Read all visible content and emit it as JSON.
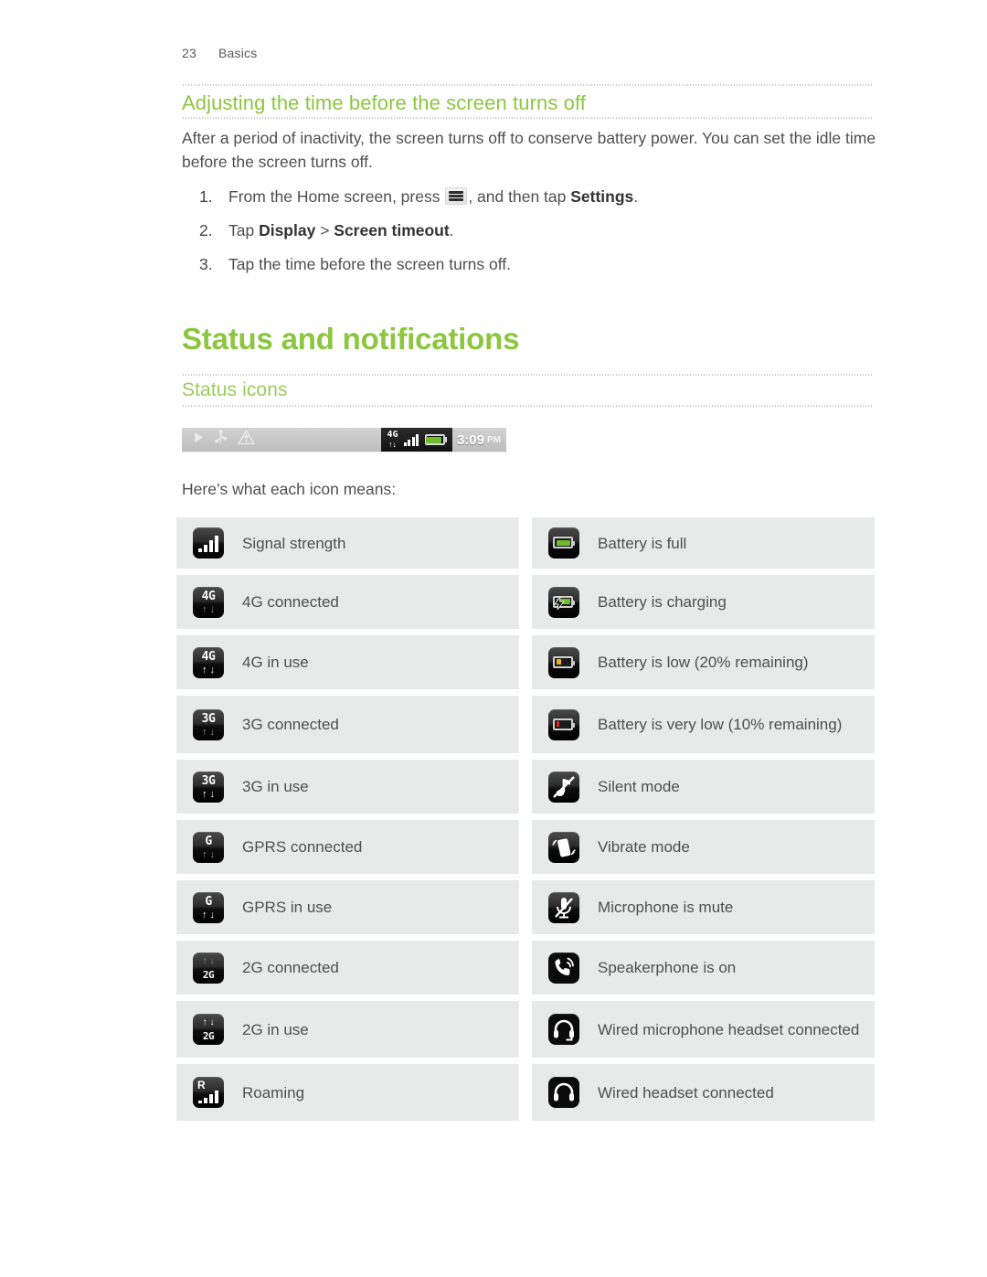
{
  "header": {
    "page_number": "23",
    "section": "Basics"
  },
  "section1": {
    "heading": "Adjusting the time before the screen turns off",
    "paragraph": "After a period of inactivity, the screen turns off to conserve battery power. You can set the idle time before the screen turns off.",
    "steps": [
      {
        "marker": "1.",
        "pre": "From the Home screen, press ",
        "post": ", and then tap ",
        "bold_end": "Settings",
        "tail": "."
      },
      {
        "marker": "2.",
        "pre": "Tap ",
        "b1": "Display",
        "mid": " > ",
        "b2": "Screen timeout",
        "tail": "."
      },
      {
        "marker": "3.",
        "pre": "Tap the time before the screen turns off.",
        "b1": "",
        "mid": "",
        "b2": "",
        "tail": ""
      }
    ]
  },
  "section2": {
    "title": "Status and notifications",
    "subheading": "Status icons",
    "statusbar": {
      "left_icons": [
        "play-icon",
        "usb-icon",
        "upload-triangle-icon"
      ],
      "network_label": "4G",
      "time": "3:09",
      "meridiem": "PM"
    },
    "intro": "Here’s what each icon means:"
  },
  "icon_table": {
    "left_column": [
      {
        "icon": "signal-strength-icon",
        "label": "Signal strength"
      },
      {
        "icon": "4g-connected-icon",
        "label": "4G connected"
      },
      {
        "icon": "4g-in-use-icon",
        "label": "4G in use"
      },
      {
        "icon": "3g-connected-icon",
        "label": "3G connected"
      },
      {
        "icon": "3g-in-use-icon",
        "label": "3G in use"
      },
      {
        "icon": "gprs-connected-icon",
        "label": "GPRS connected"
      },
      {
        "icon": "gprs-in-use-icon",
        "label": "GPRS in use"
      },
      {
        "icon": "2g-connected-icon",
        "label": "2G connected"
      },
      {
        "icon": "2g-in-use-icon",
        "label": "2G in use"
      },
      {
        "icon": "roaming-icon",
        "label": "Roaming"
      }
    ],
    "right_column": [
      {
        "icon": "battery-full-icon",
        "label": "Battery is full"
      },
      {
        "icon": "battery-charging-icon",
        "label": "Battery is charging"
      },
      {
        "icon": "battery-low-icon",
        "label": "Battery is low (20% remaining)"
      },
      {
        "icon": "battery-very-low-icon",
        "label": "Battery is very low (10% remaining)"
      },
      {
        "icon": "silent-mode-icon",
        "label": "Silent mode"
      },
      {
        "icon": "vibrate-mode-icon",
        "label": "Vibrate mode"
      },
      {
        "icon": "microphone-mute-icon",
        "label": "Microphone is mute"
      },
      {
        "icon": "speakerphone-icon",
        "label": "Speakerphone is on"
      },
      {
        "icon": "wired-microphone-headset-icon",
        "label": "Wired microphone headset connected"
      },
      {
        "icon": "wired-headset-icon",
        "label": "Wired headset connected"
      }
    ]
  },
  "colors": {
    "accent_green": "#8cc63f",
    "subhead_green": "#9acd5e",
    "body_text": "#4f4f4f",
    "row_background": "#e8eaea",
    "battery_green": "#6dbd2e",
    "battery_low_yellow": "#f2b01e",
    "battery_critical_red": "#e02b16"
  }
}
